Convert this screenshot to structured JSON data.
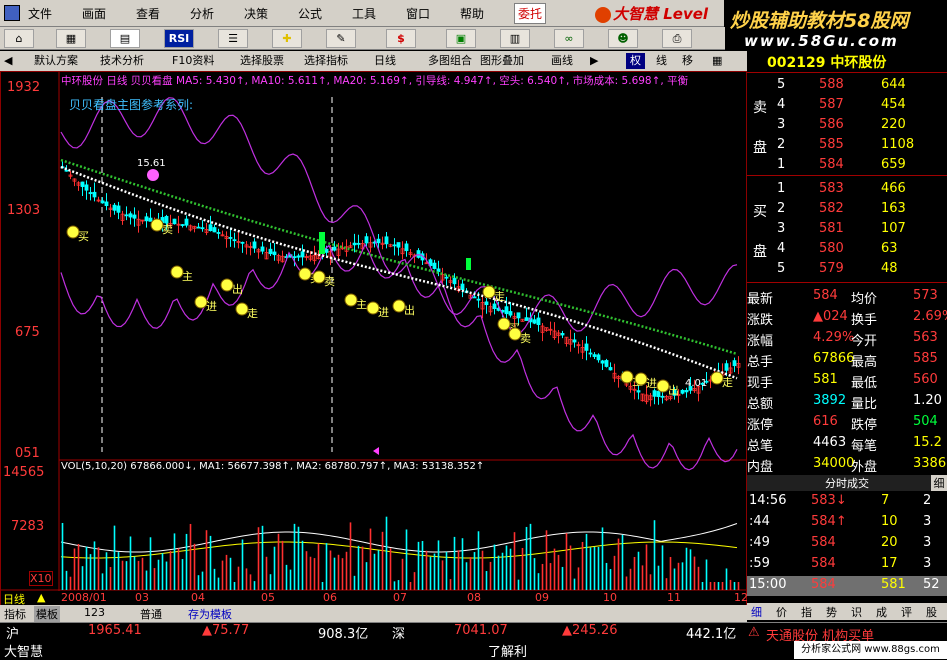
{
  "menu": {
    "items": [
      "文件",
      "画面",
      "查看",
      "分析",
      "决策",
      "公式",
      "工具",
      "窗口",
      "帮助"
    ],
    "entrust": "委托",
    "brand": "大智慧 Level"
  },
  "banner": {
    "title": "炒股辅助教材58股网",
    "url": "www.58Gu.com"
  },
  "toolbar2": {
    "items": [
      "默认方案",
      "技术分析",
      "F10资料",
      "选择股票",
      "选择指标",
      "日线",
      "多图组合",
      "图形叠加",
      "画线",
      "权",
      "线",
      "移"
    ]
  },
  "chart": {
    "header": "中环股份 日线 贝贝看盘 MA5: 5.430↑, MA10: 5.611↑, MA20: 5.169↑, 引导线: 4.947↑, 空头: 6.540↑, 市场成本: 5.698↑, 平衡",
    "subtitle": "贝贝看盘主图参考系列:",
    "yticks": [
      "1932",
      "1303",
      "675",
      "051"
    ],
    "vol_yticks": [
      "14565",
      "7283",
      "X10"
    ],
    "vol_header": "VOL(5,10,20) 67866.000↓, MA1: 56677.398↑, MA2: 68780.797↑, MA3: 53138.352↑",
    "months": [
      "2008/01",
      "03",
      "04",
      "05",
      "06",
      "07",
      "08",
      "09",
      "10",
      "11",
      "12"
    ],
    "period": "日线",
    "peak_label": "15.61",
    "low_label": "4.01",
    "signal_labels": [
      "买",
      "卖",
      "主",
      "进",
      "出",
      "走"
    ]
  },
  "chart_data": {
    "type": "candlestick",
    "title": "中环股份 日线",
    "ylim": [
      4.01,
      15.61
    ],
    "xlabel": "",
    "ylabel": "",
    "ma": {
      "MA5": 5.43,
      "MA10": 5.611,
      "MA20": 5.169,
      "引导线": 4.947,
      "空头": 6.54,
      "市场成本": 5.698
    },
    "vol": {
      "VOL": 67866.0,
      "MA1": 56677.398,
      "MA2": 68780.797,
      "MA3": 53138.352
    }
  },
  "quote": {
    "code": "002129 中环股份",
    "sell_label": [
      "卖",
      "盘"
    ],
    "buy_label": [
      "买",
      "盘"
    ],
    "sell": [
      [
        "5",
        "588",
        "644"
      ],
      [
        "4",
        "587",
        "454"
      ],
      [
        "3",
        "586",
        "220"
      ],
      [
        "2",
        "585",
        "1108"
      ],
      [
        "1",
        "584",
        "659"
      ]
    ],
    "buy": [
      [
        "1",
        "583",
        "466"
      ],
      [
        "2",
        "582",
        "163"
      ],
      [
        "3",
        "581",
        "107"
      ],
      [
        "4",
        "580",
        "63"
      ],
      [
        "5",
        "579",
        "48"
      ]
    ],
    "stats": [
      [
        "最新",
        "584",
        "均价",
        "573"
      ],
      [
        "涨跌",
        "▲024",
        "换手",
        "2.69%"
      ],
      [
        "涨幅",
        "4.29%",
        "今开",
        "563"
      ],
      [
        "总手",
        "67866",
        "最高",
        "585"
      ],
      [
        "现手",
        "581",
        "最低",
        "560"
      ],
      [
        "总额",
        "3892",
        "量比",
        "1.20"
      ],
      [
        "涨停",
        "616",
        "跌停",
        "504"
      ],
      [
        "总笔",
        "4463",
        "每笔",
        "15.2"
      ],
      [
        "内盘",
        "34000",
        "外盘",
        "33866"
      ]
    ],
    "ticks_title": "分时成交",
    "ticks": [
      [
        "14:56",
        "583↓",
        "7",
        "2"
      ],
      [
        ":44",
        "584↑",
        "10",
        "3"
      ],
      [
        ":49",
        "584",
        "20",
        "3"
      ],
      [
        ":59",
        "584",
        "17",
        "3"
      ],
      [
        "15:00",
        "584",
        "581",
        "52"
      ]
    ],
    "tabs": [
      "细",
      "价",
      "指",
      "势",
      "识",
      "成",
      "评",
      "股"
    ]
  },
  "bottom": {
    "tabs": [
      "指标",
      "模板",
      "123",
      "普通",
      "存为模板"
    ]
  },
  "status": {
    "sh": "沪",
    "sh_val": "1965.41",
    "sh_chg": "▲75.77",
    "sh_amt": "908.3亿",
    "sz": "深",
    "sz_val": "7041.07",
    "sz_chg": "▲245.26",
    "sz_amt": "442.1亿",
    "brand": "大智慧",
    "news": "了解利",
    "ticker": "天通股份 机构买单",
    "footer": "分析家公式网 www.88gs.com"
  }
}
